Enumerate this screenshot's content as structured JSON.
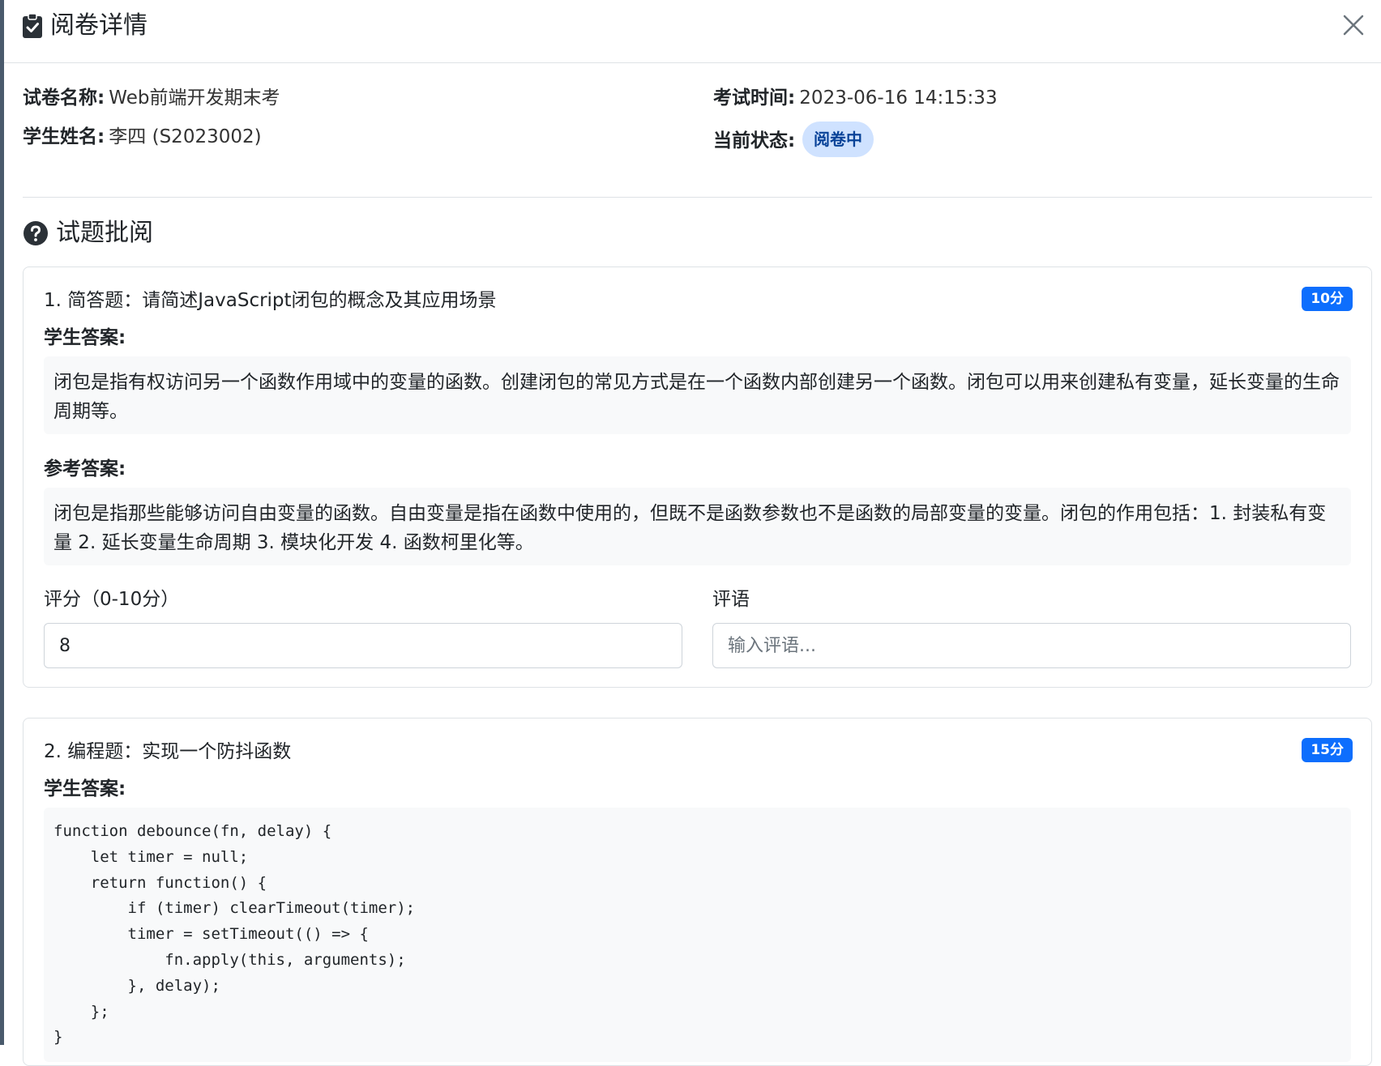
{
  "modal": {
    "title": "阅卷详情",
    "close_label": "×"
  },
  "info": {
    "exam_name_label": "试卷名称:",
    "exam_name": "Web前端开发期末考",
    "exam_time_label": "考试时间:",
    "exam_time": "2023-06-16 14:15:33",
    "student_label": "学生姓名:",
    "student_name": "李四 (S2023002)",
    "status_label": "当前状态:",
    "status": "阅卷中"
  },
  "section": {
    "title": "试题批阅"
  },
  "questions": [
    {
      "title": "1. 简答题：请简述JavaScript闭包的概念及其应用场景",
      "score_badge": "10分",
      "student_answer_label": "学生答案:",
      "student_answer": "闭包是指有权访问另一个函数作用域中的变量的函数。创建闭包的常见方式是在一个函数内部创建另一个函数。闭包可以用来创建私有变量，延长变量的生命周期等。",
      "reference_answer_label": "参考答案:",
      "reference_answer": "闭包是指那些能够访问自由变量的函数。自由变量是指在函数中使用的，但既不是函数参数也不是函数的局部变量的变量。闭包的作用包括：1. 封装私有变量 2. 延长变量生命周期 3. 模块化开发 4. 函数柯里化等。",
      "score_field_label": "评分（0-10分）",
      "score_value": "8",
      "comment_field_label": "评语",
      "comment_placeholder": "输入评语..."
    },
    {
      "title": "2. 编程题：实现一个防抖函数",
      "score_badge": "15分",
      "student_answer_label": "学生答案:",
      "student_answer_code": "function debounce(fn, delay) {\n    let timer = null;\n    return function() {\n        if (timer) clearTimeout(timer);\n        timer = setTimeout(() => {\n            fn.apply(this, arguments);\n        }, delay);\n    };\n}"
    }
  ],
  "colors": {
    "primary": "#0d6efd",
    "status_bg": "#cfe2ff",
    "status_text": "#084298",
    "answer_bg": "#f8f9fa",
    "border": "#dee2e6"
  },
  "icons": {
    "header": "clipboard-check-icon",
    "section": "question-circle-icon",
    "close": "close-icon"
  }
}
